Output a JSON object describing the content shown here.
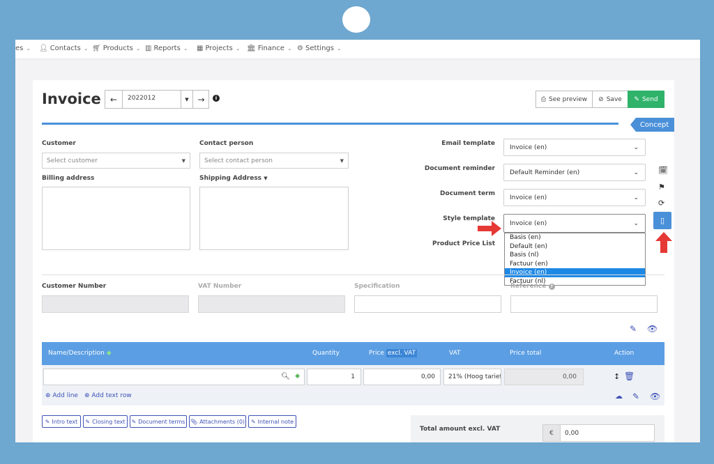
{
  "nav": {
    "partial_label": "es",
    "items": [
      {
        "label": "Contacts",
        "icon": "user-icon"
      },
      {
        "label": "Products",
        "icon": "cart-icon"
      },
      {
        "label": "Reports",
        "icon": "chart-icon"
      },
      {
        "label": "Projects",
        "icon": "calendar-icon"
      },
      {
        "label": "Finance",
        "icon": "bank-icon"
      },
      {
        "label": "Settings",
        "icon": "gear-icon"
      }
    ]
  },
  "header": {
    "title": "Invoice",
    "invoice_number": "2022012",
    "preview_label": "See preview",
    "save_label": "Save",
    "send_label": "Send",
    "status": "Concept"
  },
  "form": {
    "customer_label": "Customer",
    "customer_placeholder": "Select customer",
    "contact_label": "Contact person",
    "contact_placeholder": "Select contact person",
    "billing_label": "Billing address",
    "shipping_label": "Shipping Address",
    "email_template_label": "Email template",
    "email_template_value": "Invoice (en)",
    "reminder_label": "Document reminder",
    "reminder_value": "Default Reminder (en)",
    "term_label": "Document term",
    "term_value": "Invoice (en)",
    "style_label": "Style template",
    "style_value": "Invoice (en)",
    "price_list_label": "Product Price List",
    "style_options": [
      "Basis (en)",
      "Default (en)",
      "Basis (nl)",
      "Factuur (en)",
      "Invoice (en)",
      "Factuur (nl)"
    ],
    "style_selected_index": 4,
    "customer_number_label": "Customer Number",
    "vat_number_label": "VAT Number",
    "specification_label": "Specification",
    "reference_label": "Reference"
  },
  "table": {
    "headers": {
      "name": "Name/Description",
      "quantity": "Quantity",
      "price": "Price",
      "price_tag": "excl. VAT",
      "vat": "VAT",
      "price_total": "Price total",
      "action": "Action"
    },
    "row": {
      "quantity": "1",
      "price": "0,00",
      "vat": "21% (Hoog tarief",
      "total": "0,00"
    },
    "add_line": "Add line",
    "add_text_row": "Add text row"
  },
  "footer": {
    "buttons": [
      "Intro text",
      "Closing text",
      "Document terms",
      "Attachments (0)",
      "Internal note"
    ],
    "total_label": "Total amount excl. VAT",
    "currency": "€",
    "total_value": "0,00"
  },
  "colors": {
    "accent_blue": "#5b9ee3",
    "send_green": "#2fb36b",
    "status_blue": "#4a90d9",
    "arrow_red": "#e53935",
    "frame_blue": "#6ea7cf"
  }
}
